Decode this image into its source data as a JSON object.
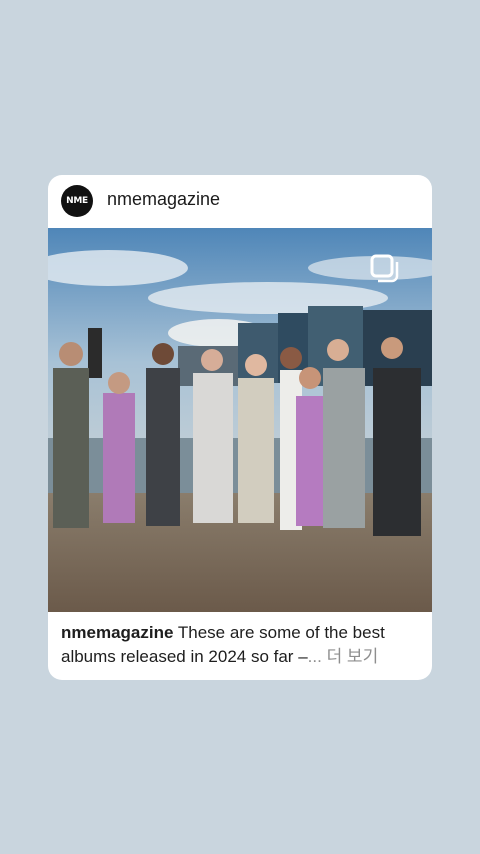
{
  "post": {
    "avatar_text": "NME",
    "username": "nmemagazine",
    "caption_user": "nmemagazine",
    "caption_text": "These are some of the best albums released in 2024 so far –",
    "ellipsis": "...",
    "more_label": "더 보기"
  },
  "icons": {
    "multi_post": "multiple-images-icon"
  },
  "colors": {
    "background": "#c9d5de",
    "card": "#ffffff",
    "more_text": "#8e8e8e"
  }
}
